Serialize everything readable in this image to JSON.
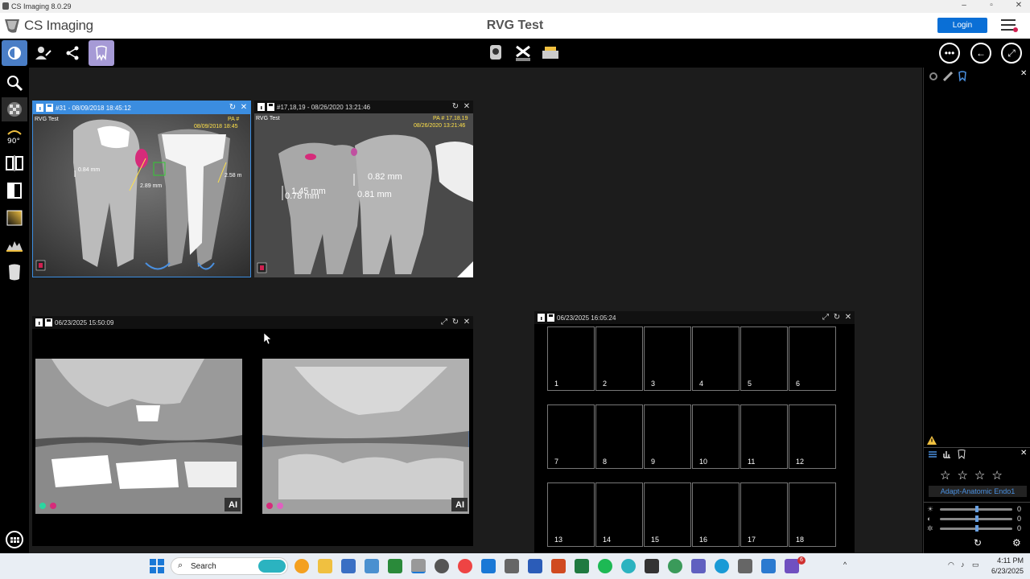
{
  "window": {
    "title": "CS Imaging 8.0.29"
  },
  "header": {
    "logo": "CS Imaging",
    "document_title": "RVG Test",
    "login_label": "Login"
  },
  "frames": {
    "top_left": {
      "title": "#31 - 08/09/2018 18:45:12",
      "patient": "RVG Test",
      "overlay_code": "PA #",
      "overlay_date": "08/09/2018 18:45",
      "measurements": [
        "0.84 mm",
        "2.89 mm",
        "2.58 m"
      ]
    },
    "top_right": {
      "title": "#17,18,19 - 08/26/2020 13:21:46",
      "patient": "RVG Test",
      "overlay_code": "PA # 17,18,19",
      "overlay_date": "08/26/2020 13:21:46",
      "measurements": [
        "1.45 mm",
        "0.78 mm",
        "0.82 mm",
        "0.81 mm"
      ]
    },
    "bottom_left": {
      "title": "06/23/2025 15:50:09",
      "ai_badge": "AI"
    },
    "bottom_right": {
      "title": "06/23/2025 16:05:24",
      "slots": [
        "1",
        "2",
        "3",
        "4",
        "5",
        "6",
        "7",
        "8",
        "9",
        "10",
        "11",
        "12",
        "13",
        "14",
        "15",
        "16",
        "17",
        "18"
      ]
    }
  },
  "right_panel": {
    "preset": "Adapt-Anatomic Endo1",
    "slider_values": [
      "0",
      "0",
      "0"
    ]
  },
  "taskbar": {
    "search": "Search",
    "time": "4:11 PM",
    "date": "6/23/2025",
    "badge": "6"
  },
  "colors": {
    "accent": "#3b8de0",
    "login": "#0a6fd6",
    "ai_button": "#a69ad6",
    "overlay_text": "#ffe14a"
  }
}
